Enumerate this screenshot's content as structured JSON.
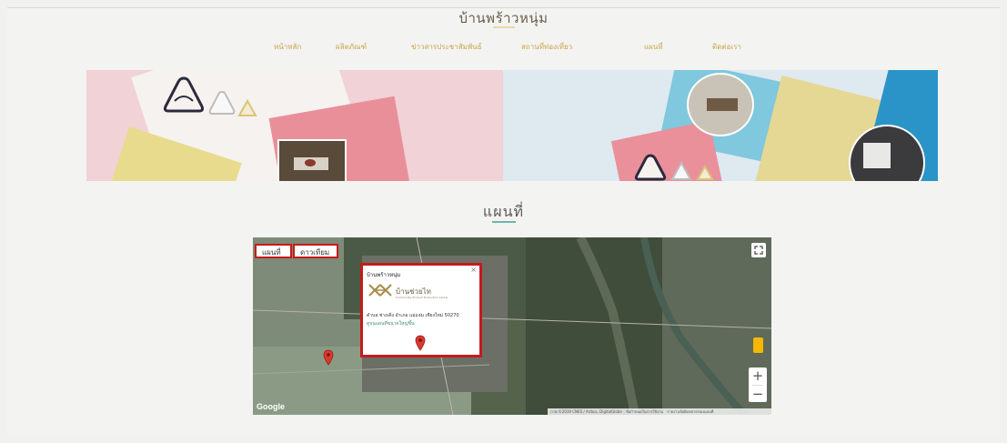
{
  "site": {
    "title": "บ้านพร้าวหนุ่ม"
  },
  "nav": {
    "items": [
      {
        "label": "หน้าหลัก"
      },
      {
        "label": "ผลิตภัณฑ์"
      },
      {
        "label": "ข่าวสารประชาสัมพันธ์"
      },
      {
        "label": "สถานที่ท่องเที่ยว"
      },
      {
        "label": "แผนที่"
      },
      {
        "label": "ติดต่อเรา"
      }
    ]
  },
  "section": {
    "title": "แผนที่"
  },
  "map": {
    "type_buttons": [
      {
        "label": "แผนที่"
      },
      {
        "label": "ดาวเทียม"
      }
    ],
    "info_window": {
      "title": "บ้านพร้าวหนุ่ม",
      "logo_text": "บ้านช่วยไท",
      "logo_sub": "Community Product Production Center",
      "address": "ตำบล ช่างเคิ่ง อำเภอ แม่แจ่ม เชียงใหม่ 50270",
      "link": "ดูบนแผนที่ขนาดใหญ่ขึ้น"
    },
    "google_logo": "Google",
    "footer": {
      "items": [
        "ภาพ ©2019 CNES / Airbus, DigitalGlobe",
        "ข้อกำหนดในการใช้งาน",
        "รายงานข้อผิดพลาดของแผนที่"
      ]
    },
    "zoom_in": "+",
    "zoom_out": "−"
  },
  "colors": {
    "nav_gold": "#c8a54b",
    "accent_teal": "#6fb4b1",
    "highlight_red": "#c51b1b",
    "pin_red": "#d93a2f"
  }
}
